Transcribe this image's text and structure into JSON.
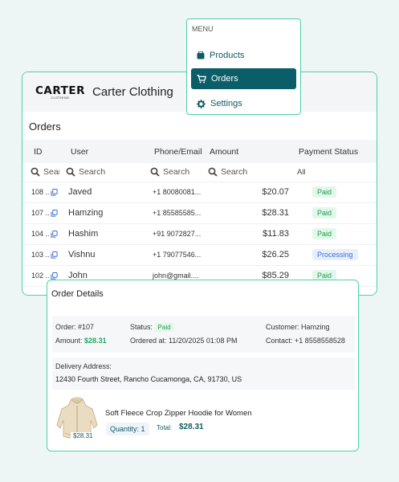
{
  "brand": {
    "logo_text": "CARTER",
    "logo_sub": "CLOTHING",
    "name": "Carter Clothing"
  },
  "menu": {
    "title": "MENU",
    "items": [
      {
        "label": "Products",
        "icon": "box-icon"
      },
      {
        "label": "Orders",
        "icon": "cart-icon"
      },
      {
        "label": "Settings",
        "icon": "gear-icon"
      }
    ]
  },
  "orders": {
    "title": "Orders",
    "columns": [
      "ID",
      "User",
      "Phone/Email",
      "Amount",
      "Payment Status"
    ],
    "search": {
      "id": "Search",
      "user": "Search",
      "phone": "Search",
      "amount": "Search",
      "status": "All"
    },
    "rows": [
      {
        "id": "108 ..",
        "user": "Javed",
        "phone": "+1 80080081...",
        "amount": "$20.07",
        "status": "Paid"
      },
      {
        "id": "107 ..",
        "user": "Hamzing",
        "phone": "+1 85585585...",
        "amount": "$28.31",
        "status": "Paid"
      },
      {
        "id": "104 ..",
        "user": "Hashim",
        "phone": "+91 9072827...",
        "amount": "$11.83",
        "status": "Paid"
      },
      {
        "id": "103 ..",
        "user": "Vishnu",
        "phone": "+1 79077546...",
        "amount": "$26.25",
        "status": "Processing"
      },
      {
        "id": "102 ..",
        "user": "John",
        "phone": "john@gmail....",
        "amount": "$85.29",
        "status": "Paid"
      }
    ]
  },
  "details": {
    "title": "Order Details",
    "order_label": "Order:",
    "order_value": "#107",
    "amount_label": "Amount:",
    "amount_value": "$28.31",
    "status_label": "Status:",
    "status_value": "Paid",
    "ordered_label": "Ordered at:",
    "ordered_value": "11/20/2025 01:08 PM",
    "customer_label": "Customer:",
    "customer_value": "Hamzing",
    "contact_label": "Contact:",
    "contact_value": "+1 8558558528",
    "address_label": "Delivery Address:",
    "address_value": "12430 Fourth Street, Rancho Cucamonga, CA, 91730, US",
    "product": {
      "name": "Soft Fleece Crop Zipper Hoodie for Women",
      "price": "$28.31",
      "quantity_text": "Quantity: 1",
      "total_label": "Total:",
      "total_value": "$28.31"
    }
  },
  "colors": {
    "accent": "#0b5e68",
    "border": "#4fd1a8",
    "paid": "#1d9c50",
    "processing": "#3b6fd6"
  }
}
